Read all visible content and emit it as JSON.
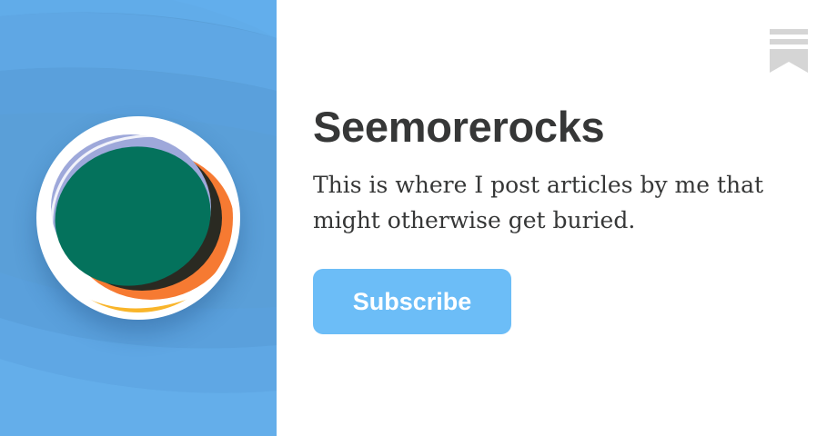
{
  "publication": {
    "name": "Seemorerocks",
    "description": "This is where I post articles by me that might otherwise get buried.",
    "logo_icon": "circular-green-disc-logo-icon"
  },
  "actions": {
    "subscribe_label": "Subscribe"
  },
  "icons": {
    "brand": "substack-bookmark-icon"
  },
  "colors": {
    "left_panel_background": "#5a9fd8",
    "wave_light": "#66b3ee",
    "accent_button": "#6cbdf7",
    "text": "#363737",
    "logo_green": "#04725c",
    "logo_orange": "#f67a32",
    "logo_yellow": "#f9b52a",
    "logo_lavender": "#9ea8da",
    "brand_icon_gray": "#d5d5d5"
  }
}
